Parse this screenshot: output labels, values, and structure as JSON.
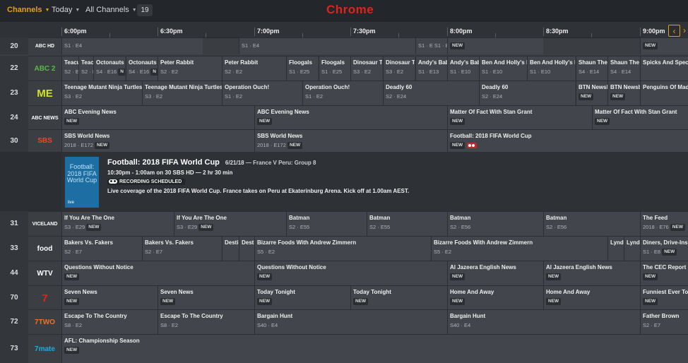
{
  "app": {
    "title": "Chrome"
  },
  "toolbar": {
    "channels_label": "Channels",
    "today_label": "Today",
    "all_channels_label": "All Channels",
    "count": "19"
  },
  "timebar": {
    "slots": [
      "6:00pm",
      "6:30pm",
      "7:00pm",
      "7:30pm",
      "8:00pm",
      "8:30pm",
      "9:00pm"
    ],
    "scroll_left_icon": "chevron-left-icon",
    "scroll_right_icon": "chevron-right-icon"
  },
  "channels": [
    {
      "num": "20",
      "logo": "ABC HD",
      "logo_color": "#ffffff",
      "programs": [
        {
          "title": "",
          "meta": "S1 · E4",
          "badge": ""
        },
        {
          "title": "",
          "meta": "S1 · E4",
          "badge": ""
        },
        {
          "title": "",
          "meta": "S1 · E S1 · E",
          "badge": "NEW"
        },
        {
          "title": "",
          "meta": "",
          "badge": "NEW"
        },
        {
          "title": "",
          "meta": "",
          "badge": "NEW"
        }
      ]
    },
    {
      "num": "22",
      "logo": "ABC 2",
      "logo_color": "#57b947",
      "programs": [
        {
          "title": "Teacu",
          "meta": "S2 · E",
          "badge": ""
        },
        {
          "title": "Teacu",
          "meta": "S2 · E",
          "badge": ""
        },
        {
          "title": "Octonauts",
          "meta": "S4 · E16",
          "badge": "N"
        },
        {
          "title": "Octonauts",
          "meta": "S4 · E16",
          "badge": "N"
        },
        {
          "title": "Peter Rabbit",
          "meta": "S2 · E2",
          "badge": ""
        },
        {
          "title": "Peter Rabbit",
          "meta": "S2 · E2",
          "badge": ""
        },
        {
          "title": "Floogals",
          "meta": "S1 · E25",
          "badge": ""
        },
        {
          "title": "Floogals",
          "meta": "S1 · E25",
          "badge": ""
        },
        {
          "title": "Dinosaur Tr",
          "meta": "S3 · E2",
          "badge": ""
        },
        {
          "title": "Dinosaur Tr",
          "meta": "S3 · E2",
          "badge": ""
        },
        {
          "title": "Andy's Baby",
          "meta": "S1 · E13",
          "badge": ""
        },
        {
          "title": "Andy's Baby",
          "meta": "S1 · E10",
          "badge": ""
        },
        {
          "title": "Ben And Holly's Li",
          "meta": "S1 · E10",
          "badge": ""
        },
        {
          "title": "Ben And Holly's Li",
          "meta": "S1 · E10",
          "badge": ""
        },
        {
          "title": "Shaun The S",
          "meta": "S4 · E14",
          "badge": ""
        },
        {
          "title": "Shaun The S",
          "meta": "S4 · E14",
          "badge": ""
        },
        {
          "title": "Spicks And Specks",
          "meta": "",
          "badge": ""
        }
      ]
    },
    {
      "num": "23",
      "logo": "ME",
      "logo_color": "#d5e21e",
      "programs": [
        {
          "title": "Teenage Mutant Ninja Turtles",
          "meta": "S3 · E2",
          "badge": ""
        },
        {
          "title": "Teenage Mutant Ninja Turtles",
          "meta": "S3 · E2",
          "badge": ""
        },
        {
          "title": "Operation Ouch!",
          "meta": "S1 · E2",
          "badge": ""
        },
        {
          "title": "Operation Ouch!",
          "meta": "S1 · E2",
          "badge": ""
        },
        {
          "title": "Deadly 60",
          "meta": "S2 · E24",
          "badge": ""
        },
        {
          "title": "Deadly 60",
          "meta": "S2 · E24",
          "badge": ""
        },
        {
          "title": "BTN Newsb",
          "meta": "",
          "badge": "NEW"
        },
        {
          "title": "BTN Newsb",
          "meta": "",
          "badge": "NEW"
        },
        {
          "title": "Penguins Of Madaga",
          "meta": "",
          "badge": ""
        }
      ]
    },
    {
      "num": "24",
      "logo": "ABC NEWS",
      "logo_color": "#ffffff",
      "programs": [
        {
          "title": "ABC Evening News",
          "meta": "",
          "badge": "NEW"
        },
        {
          "title": "ABC Evening News",
          "meta": "",
          "badge": "NEW"
        },
        {
          "title": "Matter Of Fact With Stan Grant",
          "meta": "",
          "badge": "NEW"
        },
        {
          "title": "Matter Of Fact With Stan Grant",
          "meta": "",
          "badge": "NEW"
        }
      ]
    },
    {
      "num": "30",
      "logo": "SBS",
      "logo_color": "#e8482f",
      "programs": [
        {
          "title": "SBS World News",
          "meta": "2018 · E172",
          "badge": "NEW"
        },
        {
          "title": "SBS World News",
          "meta": "2018 · E172",
          "badge": "NEW"
        },
        {
          "title": "Football: 2018 FIFA World Cup",
          "meta": "",
          "badge": "NEW"
        }
      ]
    },
    {
      "num": "31",
      "logo": "VICELAND",
      "logo_color": "#ffffff",
      "programs": [
        {
          "title": "If You Are The One",
          "meta": "S3 · E29",
          "badge": "NEW"
        },
        {
          "title": "If You Are The One",
          "meta": "S3 · E29",
          "badge": "NEW"
        },
        {
          "title": "Batman",
          "meta": "S2 · E55",
          "badge": ""
        },
        {
          "title": "Batman",
          "meta": "S2 · E55",
          "badge": ""
        },
        {
          "title": "Batman",
          "meta": "S2 · E56",
          "badge": ""
        },
        {
          "title": "Batman",
          "meta": "S2 · E56",
          "badge": ""
        },
        {
          "title": "The Feed",
          "meta": "2018 · E76",
          "badge": "NEW"
        }
      ]
    },
    {
      "num": "33",
      "logo": "food",
      "logo_color": "#ffffff",
      "programs": [
        {
          "title": "Bakers Vs. Fakers",
          "meta": "S2 · E7",
          "badge": ""
        },
        {
          "title": "Bakers Vs. Fakers",
          "meta": "S2 · E7",
          "badge": ""
        },
        {
          "title": "Desti",
          "meta": "",
          "badge": ""
        },
        {
          "title": "Desti",
          "meta": "",
          "badge": ""
        },
        {
          "title": "Bizarre Foods With Andrew Zimmern",
          "meta": "S5 · E2",
          "badge": ""
        },
        {
          "title": "Bizarre Foods With Andrew Zimmern",
          "meta": "S5 · E2",
          "badge": ""
        },
        {
          "title": "Lynda",
          "meta": "",
          "badge": ""
        },
        {
          "title": "Lynda",
          "meta": "",
          "badge": ""
        },
        {
          "title": "Diners, Drive-Ins A",
          "meta": "S1 · E8",
          "badge": "NEW"
        }
      ]
    },
    {
      "num": "44",
      "logo": "WTV",
      "logo_color": "#ffffff",
      "programs": [
        {
          "title": "Questions Without Notice",
          "meta": "",
          "badge": "NEW"
        },
        {
          "title": "Questions Without Notice",
          "meta": "",
          "badge": "NEW"
        },
        {
          "title": "Al Jazeera English News",
          "meta": "",
          "badge": "NEW"
        },
        {
          "title": "Al Jazeera English News",
          "meta": "",
          "badge": "NEW"
        },
        {
          "title": "The CEC Report",
          "meta": "",
          "badge": "NEW"
        }
      ]
    },
    {
      "num": "70",
      "logo": "7",
      "logo_color": "#e2231a",
      "programs": [
        {
          "title": "Seven News",
          "meta": "",
          "badge": "NEW"
        },
        {
          "title": "Seven News",
          "meta": "",
          "badge": "NEW"
        },
        {
          "title": "Today Tonight",
          "meta": "",
          "badge": "NEW"
        },
        {
          "title": "Today Tonight",
          "meta": "",
          "badge": "NEW"
        },
        {
          "title": "Home And Away",
          "meta": "",
          "badge": "NEW"
        },
        {
          "title": "Home And Away",
          "meta": "",
          "badge": "NEW"
        },
        {
          "title": "Funniest Ever Toda",
          "meta": "",
          "badge": "NEW"
        }
      ]
    },
    {
      "num": "72",
      "logo": "7TWO",
      "logo_color": "#f36f21",
      "programs": [
        {
          "title": "Escape To The Country",
          "meta": "S8 · E2",
          "badge": ""
        },
        {
          "title": "Escape To The Country",
          "meta": "S8 · E2",
          "badge": ""
        },
        {
          "title": "Bargain Hunt",
          "meta": "S40 · E4",
          "badge": ""
        },
        {
          "title": "Bargain Hunt",
          "meta": "S40 · E4",
          "badge": ""
        },
        {
          "title": "Father Brown",
          "meta": "S2 · E7",
          "badge": ""
        }
      ]
    },
    {
      "num": "73",
      "logo": "7mate",
      "logo_color": "#24a8e0",
      "programs": [
        {
          "title": "AFL: Championship Season",
          "meta": "",
          "badge": "NEW"
        }
      ]
    }
  ],
  "detail": {
    "poster_text": "Football: 2018 FIFA World Cup",
    "poster_logo": "live",
    "title": "Football: 2018 FIFA World Cup",
    "date": "6/21/18",
    "subtitle": "France V Peru: Group 8",
    "time": "10:30pm - 1:00am on 30 SBS HD — 2 hr 30 min",
    "recording": "RECORDING SCHEDULED",
    "description": "Live coverage of the 2018 FIFA World Cup. France takes on Peru at Ekaterinburg Arena. Kick off at 1.00am AEST."
  },
  "colors": {
    "accent": "#e5a00d",
    "title_red": "#e0231d",
    "record_red": "#c1272d"
  }
}
